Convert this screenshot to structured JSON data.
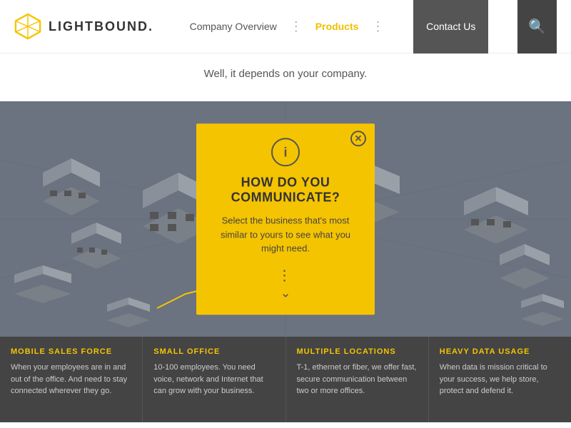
{
  "header": {
    "logo_text": "LIGHTBOUND.",
    "nav": {
      "company_overview": "Company Overview",
      "products": "Products",
      "contact_us": "Contact Us"
    },
    "search_icon": "🔍"
  },
  "subtitle": {
    "text": "Well, it depends on your company."
  },
  "modal": {
    "title_line1": "HOW DO YOU",
    "title_line2": "COMMUNICATE?",
    "body": "Select the business that's most similar to yours to see what you might need."
  },
  "cards": [
    {
      "title": "MOBILE SALES FORCE",
      "desc": "When your employees are in and out of the office. And need to stay connected wherever they go."
    },
    {
      "title": "SMALL OFFICE",
      "desc": "10-100 employees. You need voice, network and Internet that can grow with your business."
    },
    {
      "title": "MULTIPLE LOCATIONS",
      "desc": "T-1, ethernet or fiber, we offer fast, secure communication between two or more offices."
    },
    {
      "title": "HEAVY DATA USAGE",
      "desc": "When data is mission critical to your success, we help store, protect and defend it."
    }
  ],
  "colors": {
    "yellow": "#f5c400",
    "dark_bg": "#6b7280",
    "card_bg": "#444",
    "card_title_yellow": "#f5c400"
  }
}
